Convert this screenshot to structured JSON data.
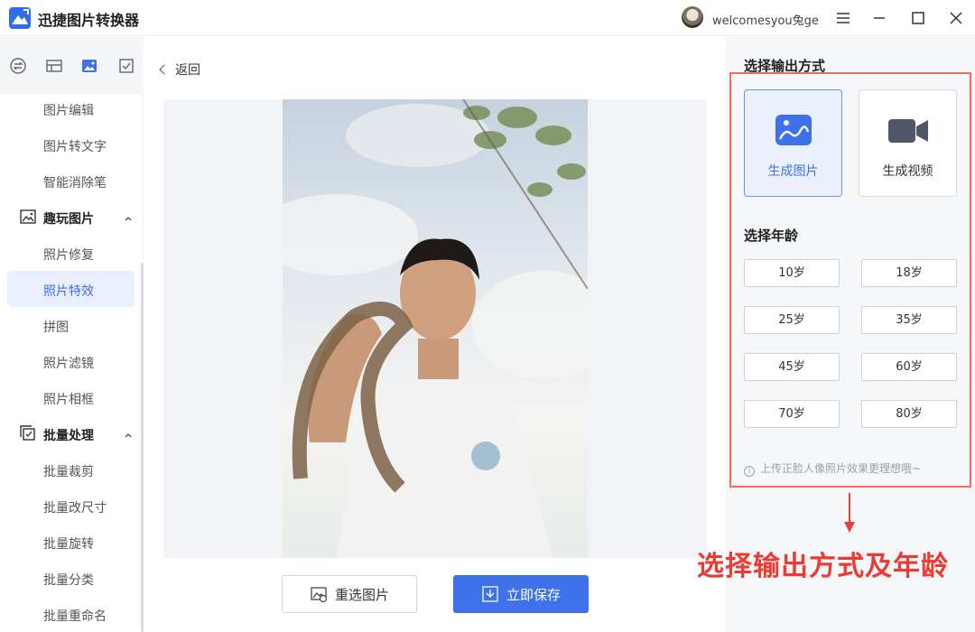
{
  "window": {
    "title": "迅捷图片转换器",
    "username": "welcomesyou兔ge"
  },
  "sidebar": {
    "top_icons": [
      "convert-icon",
      "layout-icon",
      "image-icon",
      "checkbox-icon"
    ],
    "items_a": [
      "图片编辑",
      "图片转文字",
      "智能消除笔"
    ],
    "group_fun": {
      "label": "趣玩图片",
      "items": [
        "照片修复",
        "照片特效",
        "拼图",
        "照片滤镜",
        "照片相框"
      ],
      "active": "照片特效"
    },
    "group_batch": {
      "label": "批量处理",
      "items": [
        "批量裁剪",
        "批量改尺寸",
        "批量旋转",
        "批量分类",
        "批量重命名"
      ]
    }
  },
  "main": {
    "back_label": "返回",
    "reselect_label": "重选图片",
    "save_label": "立即保存"
  },
  "panel": {
    "output_title": "选择输出方式",
    "modes": [
      {
        "label": "生成图片",
        "icon": "image-icon",
        "selected": true
      },
      {
        "label": "生成视频",
        "icon": "video-icon",
        "selected": false
      }
    ],
    "age_title": "选择年龄",
    "ages": [
      "10岁",
      "18岁",
      "25岁",
      "35岁",
      "45岁",
      "60岁",
      "70岁",
      "80岁"
    ],
    "tip": "上传正脸人像照片效果更理想哦~"
  },
  "annotation": {
    "text": "选择输出方式及年龄",
    "color": "#ec3b33"
  },
  "colors": {
    "accent": "#3f72ea",
    "highlight_border": "#f36a60"
  }
}
